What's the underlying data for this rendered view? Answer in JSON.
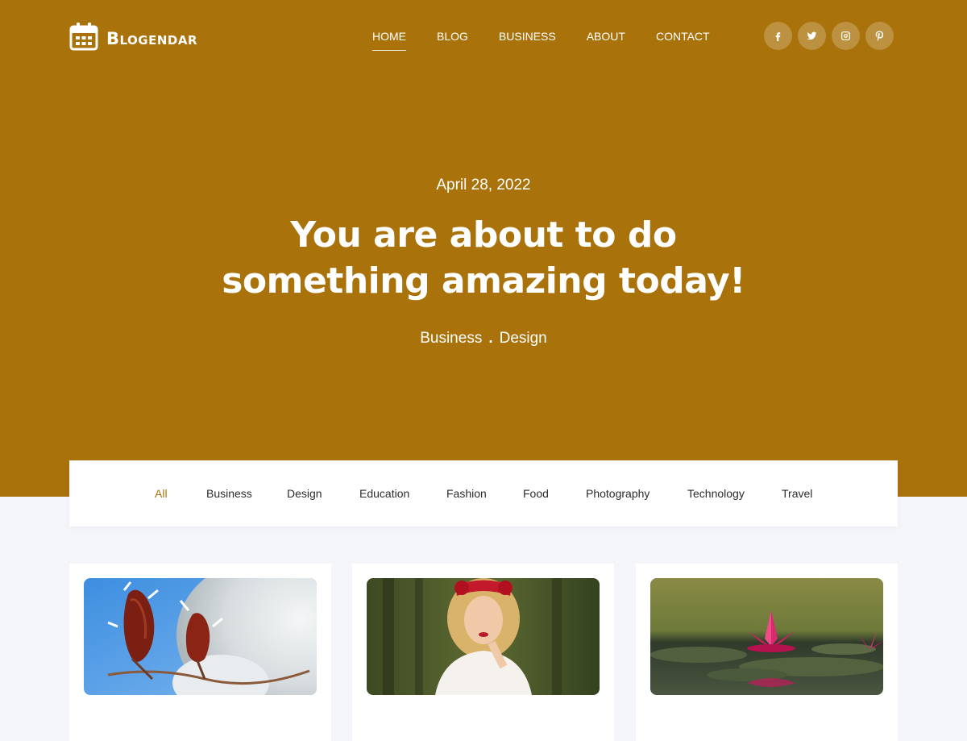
{
  "site": {
    "name": "Blogendar",
    "logo_icon": "calendar-icon"
  },
  "nav": {
    "items": [
      {
        "label": "HOME",
        "active": true
      },
      {
        "label": "BLOG",
        "active": false
      },
      {
        "label": "BUSINESS",
        "active": false
      },
      {
        "label": "ABOUT",
        "active": false
      },
      {
        "label": "CONTACT",
        "active": false
      }
    ]
  },
  "social": [
    {
      "name": "facebook-icon",
      "glyph": "f"
    },
    {
      "name": "twitter-icon"
    },
    {
      "name": "instagram-icon"
    },
    {
      "name": "pinterest-icon"
    }
  ],
  "hero": {
    "date": "April 28, 2022",
    "title": "You are about to do something amazing today!",
    "categories": [
      "Business",
      "Design"
    ],
    "separator": ".",
    "background_color": "#a9720b"
  },
  "filters": {
    "active_color": "#a9720b",
    "items": [
      {
        "label": "All",
        "active": true
      },
      {
        "label": "Business",
        "active": false
      },
      {
        "label": "Design",
        "active": false
      },
      {
        "label": "Education",
        "active": false
      },
      {
        "label": "Fashion",
        "active": false
      },
      {
        "label": "Food",
        "active": false
      },
      {
        "label": "Photography",
        "active": false
      },
      {
        "label": "Technology",
        "active": false
      },
      {
        "label": "Travel",
        "active": false
      }
    ]
  },
  "cards": [
    {
      "image": "frosted-branch-image"
    },
    {
      "image": "woman-flower-crown-image"
    },
    {
      "image": "pink-water-lily-image"
    }
  ]
}
